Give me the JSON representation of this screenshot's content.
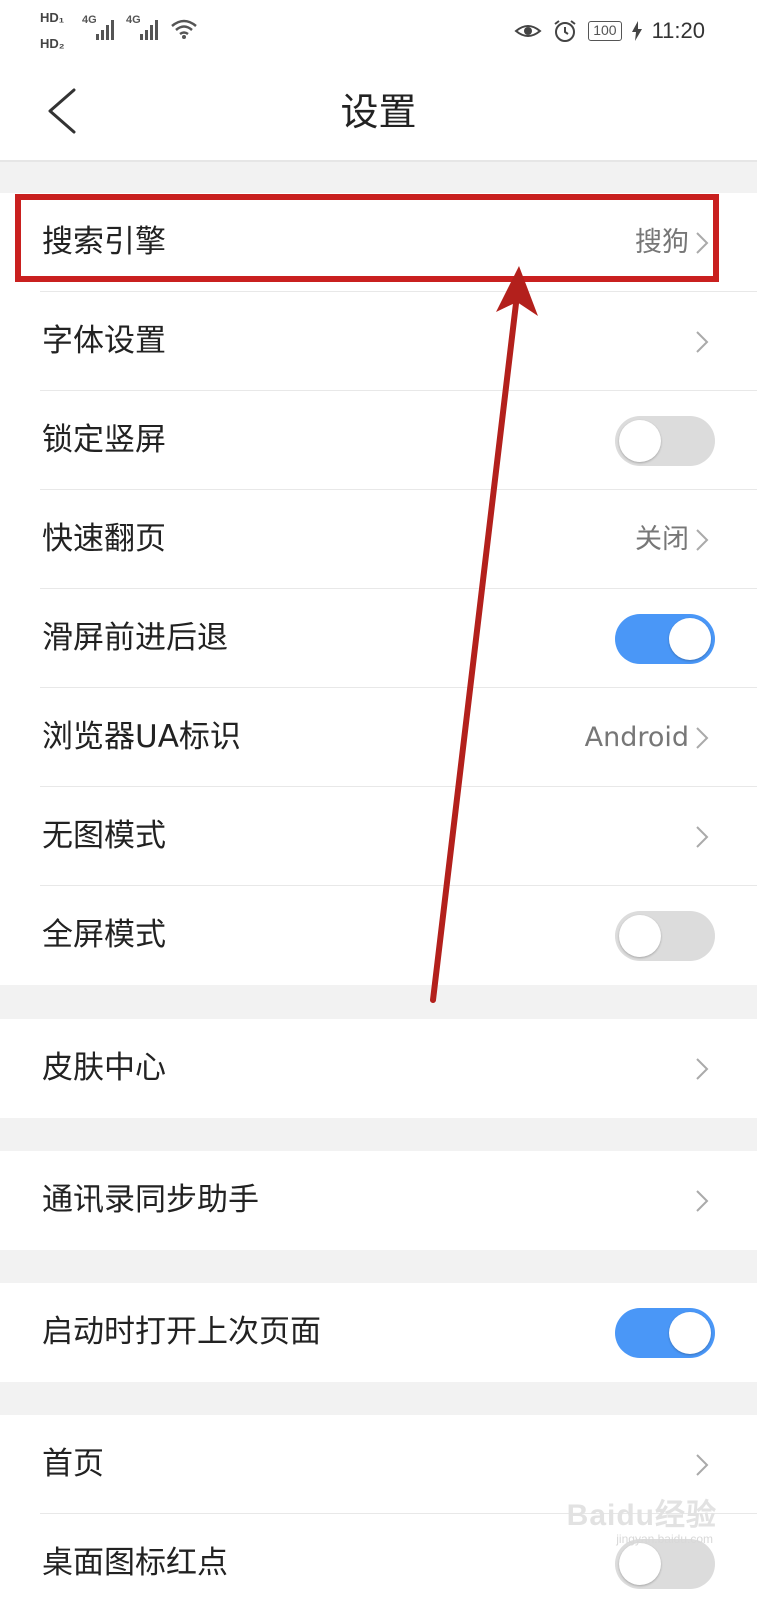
{
  "status_bar": {
    "hd1": "HD₁",
    "hd2": "HD₂",
    "net1": "4G",
    "net2": "4G",
    "battery": "100",
    "time": "11:20"
  },
  "header": {
    "title": "设置"
  },
  "settings": {
    "search_engine": {
      "label": "搜索引擎",
      "value": "搜狗"
    },
    "font_settings": {
      "label": "字体设置"
    },
    "lock_portrait": {
      "label": "锁定竖屏",
      "on": false
    },
    "quick_page": {
      "label": "快速翻页",
      "value": "关闭"
    },
    "swipe_nav": {
      "label": "滑屏前进后退",
      "on": true
    },
    "ua": {
      "label": "浏览器UA标识",
      "value": "Android"
    },
    "no_image": {
      "label": "无图模式"
    },
    "fullscreen": {
      "label": "全屏模式",
      "on": false
    },
    "skin_center": {
      "label": "皮肤中心"
    },
    "contacts_sync": {
      "label": "通讯录同步助手"
    },
    "restore_last": {
      "label": "启动时打开上次页面",
      "on": true
    },
    "home": {
      "label": "首页"
    },
    "desktop_badge": {
      "label": "桌面图标红点",
      "on": false
    }
  },
  "watermark": {
    "text": "Baidu经验",
    "sub": "jingyan.baidu.com"
  },
  "colors": {
    "accent": "#4a97f7",
    "annotation": "#c9201f"
  }
}
